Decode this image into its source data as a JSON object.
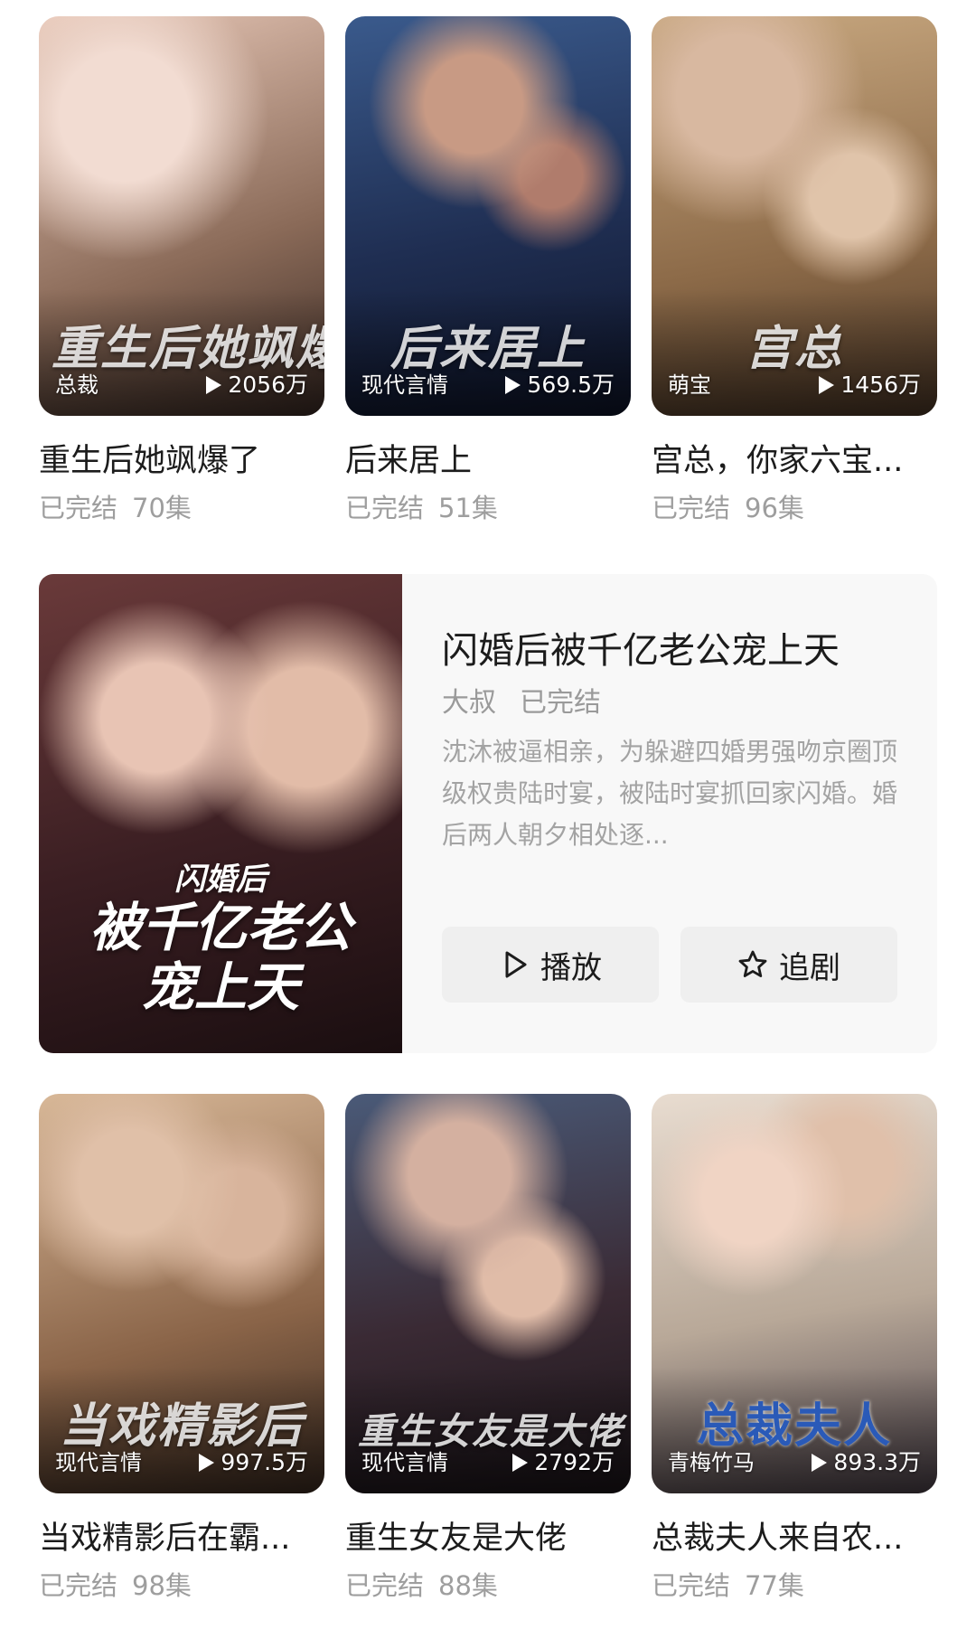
{
  "top_row": [
    {
      "genre": "总裁",
      "plays": "2056万",
      "title": "重生后她飒爆了",
      "status": "已完结",
      "episodes": "70集",
      "poster_text": "重生后她飒爆了",
      "colors": [
        "#e8c8b8",
        "#8a6a58",
        "#3a2a24"
      ]
    },
    {
      "genre": "现代言情",
      "plays": "569.5万",
      "title": "后来居上",
      "status": "已完结",
      "episodes": "51集",
      "poster_text": "后来居上",
      "colors": [
        "#3a5a8c",
        "#1f2e52",
        "#0e1428"
      ]
    },
    {
      "genre": "萌宝",
      "plays": "1456万",
      "title": "宫总，你家六宝...",
      "status": "已完结",
      "episodes": "96集",
      "poster_text": "宫总",
      "colors": [
        "#c8a880",
        "#8c6a48",
        "#4a3626"
      ]
    }
  ],
  "featured": {
    "title": "闪婚后被千亿老公宠上天",
    "tags": [
      "大叔",
      "已完结"
    ],
    "description": "沈沐被逼相亲，为躲避四婚男强吻京圈顶级权贵陆时宴，被陆时宴抓回家闪婚。婚后两人朝夕相处逐...",
    "poster_line1": "闪婚后",
    "poster_line2": "被千亿老公",
    "poster_line3": "宠上天",
    "play_label": "播放",
    "follow_label": "追剧",
    "colors": [
      "#6a3a3a",
      "#3a1e22",
      "#1a0e10"
    ]
  },
  "bottom_row": [
    {
      "genre": "现代言情",
      "plays": "997.5万",
      "title": "当戏精影后在霸...",
      "status": "已完结",
      "episodes": "98集",
      "poster_text": "当戏精影后",
      "colors": [
        "#d8b898",
        "#8a6448",
        "#3a2a20"
      ]
    },
    {
      "genre": "现代言情",
      "plays": "2792万",
      "title": "重生女友是大佬",
      "status": "已完结",
      "episodes": "88集",
      "poster_text": "重生女友是大佬",
      "colors": [
        "#4a5a78",
        "#3a2a34",
        "#1a1418"
      ]
    },
    {
      "genre": "青梅竹马",
      "plays": "893.3万",
      "title": "总裁夫人来自农...",
      "status": "已完结",
      "episodes": "77集",
      "poster_text": "总裁夫人",
      "colors": [
        "#e8dcd0",
        "#b8a898",
        "#4a4048"
      ]
    }
  ]
}
